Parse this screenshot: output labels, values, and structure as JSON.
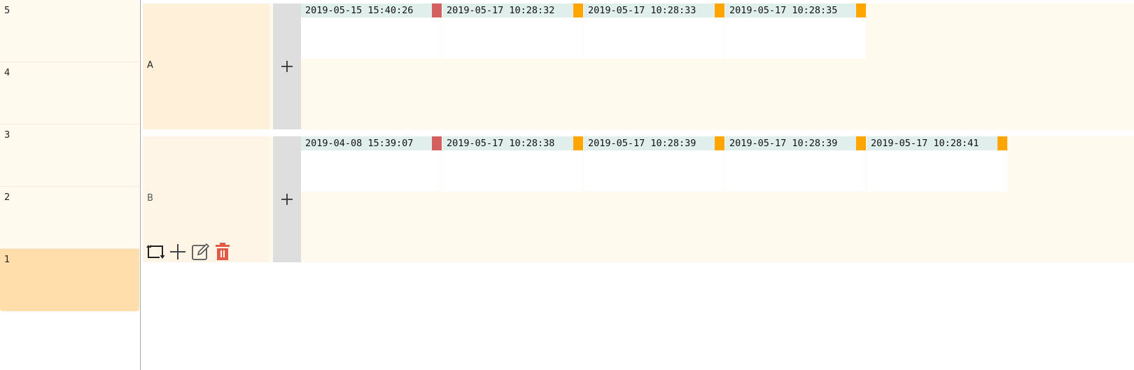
{
  "levels": [
    "5",
    "4",
    "3",
    "2",
    "1"
  ],
  "active_level": "1",
  "groups": [
    {
      "label": "A",
      "cards": [
        {
          "timestamp": "2019-05-15 15:40:26",
          "flag_color": "#d35f5f"
        },
        {
          "timestamp": "2019-05-17 10:28:32",
          "flag_color": "#ffa500"
        },
        {
          "timestamp": "2019-05-17 10:28:33",
          "flag_color": "#ffa500"
        },
        {
          "timestamp": "2019-05-17 10:28:35",
          "flag_color": "#ffa500"
        }
      ]
    },
    {
      "label": "B",
      "cards": [
        {
          "timestamp": "2019-04-08 15:39:07",
          "flag_color": "#d35f5f"
        },
        {
          "timestamp": "2019-05-17 10:28:38",
          "flag_color": "#ffa500"
        },
        {
          "timestamp": "2019-05-17 10:28:39",
          "flag_color": "#ffa500"
        },
        {
          "timestamp": "2019-05-17 10:28:39",
          "flag_color": "#ffa500"
        },
        {
          "timestamp": "2019-05-17 10:28:41",
          "flag_color": "#ffa500"
        }
      ]
    }
  ],
  "toolbar_icons": [
    "swap-icon",
    "add-icon",
    "edit-icon",
    "trash-icon"
  ],
  "colors": {
    "error_flag": "#d35f5f",
    "warning_flag": "#ffa500",
    "delete": "#e05a47"
  }
}
